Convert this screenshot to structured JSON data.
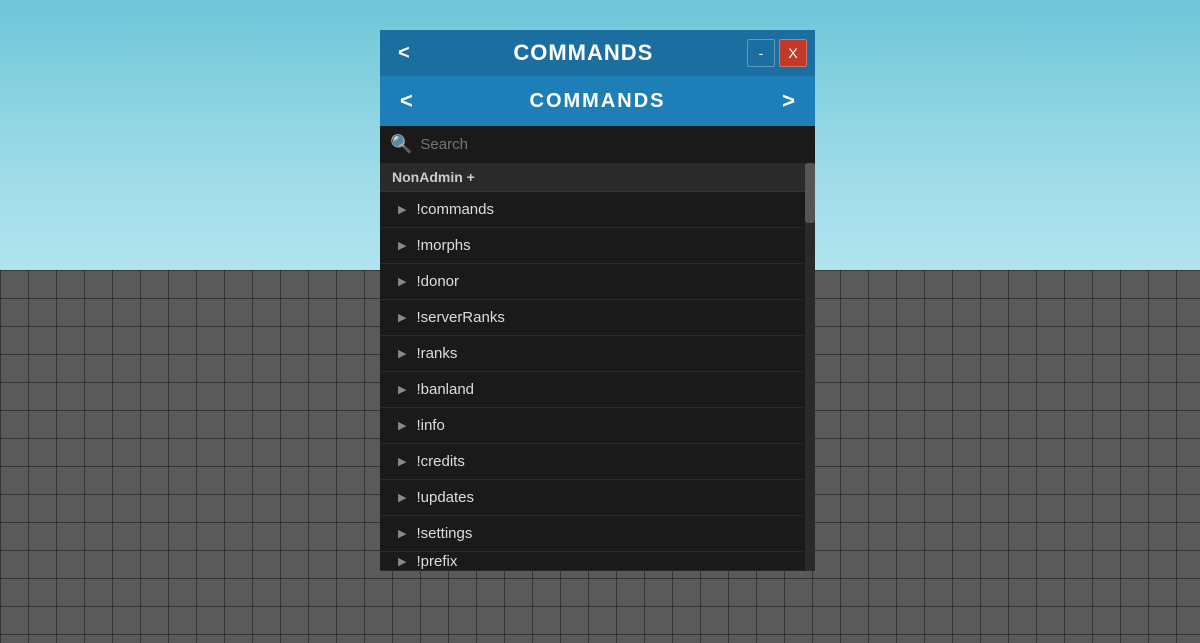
{
  "background": {
    "sky_color_top": "#6ec6d8",
    "sky_color_bottom": "#b5e5ef",
    "floor_color": "#5a5a5a"
  },
  "title_bar": {
    "back_label": "<",
    "title": "COMMANDS",
    "minimize_label": "-",
    "close_label": "X"
  },
  "sub_header": {
    "prev_label": "<",
    "title": "COMMANDS",
    "next_label": ">"
  },
  "search": {
    "placeholder": "Search",
    "icon": "🔍"
  },
  "category": {
    "label": "NonAdmin +"
  },
  "commands": [
    {
      "name": "!commands"
    },
    {
      "name": "!morphs"
    },
    {
      "name": "!donor"
    },
    {
      "name": "!serverRanks"
    },
    {
      "name": "!ranks"
    },
    {
      "name": "!banland"
    },
    {
      "name": "!info"
    },
    {
      "name": "!credits"
    },
    {
      "name": "!updates"
    },
    {
      "name": "!settings"
    },
    {
      "name": "!prefix"
    }
  ]
}
